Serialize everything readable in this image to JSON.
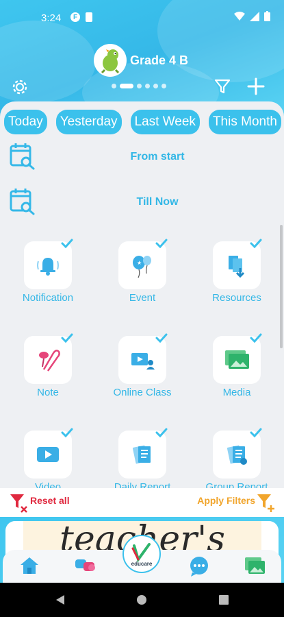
{
  "status": {
    "time": "3:24"
  },
  "header": {
    "title": "Grade 4 B",
    "page_count": 6,
    "active_page": 2
  },
  "date_chips": [
    "Today",
    "Yesterday",
    "Last Week",
    "This Month"
  ],
  "date_range": {
    "from_label": "From start",
    "to_label": "Till Now"
  },
  "tiles": [
    {
      "label": "Notification",
      "icon": "bell-icon",
      "checked": true
    },
    {
      "label": "Event",
      "icon": "balloons-icon",
      "checked": true
    },
    {
      "label": "Resources",
      "icon": "download-files-icon",
      "checked": true
    },
    {
      "label": "Note",
      "icon": "pin-paperclip-icon",
      "checked": true
    },
    {
      "label": "Online Class",
      "icon": "video-lesson-icon",
      "checked": true
    },
    {
      "label": "Media",
      "icon": "images-icon",
      "checked": true
    },
    {
      "label": "Video",
      "icon": "play-icon",
      "checked": true
    },
    {
      "label": "Daily Report",
      "icon": "report-icon",
      "checked": true
    },
    {
      "label": "Group Report",
      "icon": "group-report-icon",
      "checked": true
    }
  ],
  "filters": {
    "reset_label": "Reset all",
    "apply_label": "Apply Filters"
  },
  "banner": {
    "text": "teacher's"
  },
  "logo": {
    "text": "educare"
  },
  "colors": {
    "accent": "#3bc1ec",
    "reset": "#e0293f",
    "apply": "#f1a52c"
  }
}
